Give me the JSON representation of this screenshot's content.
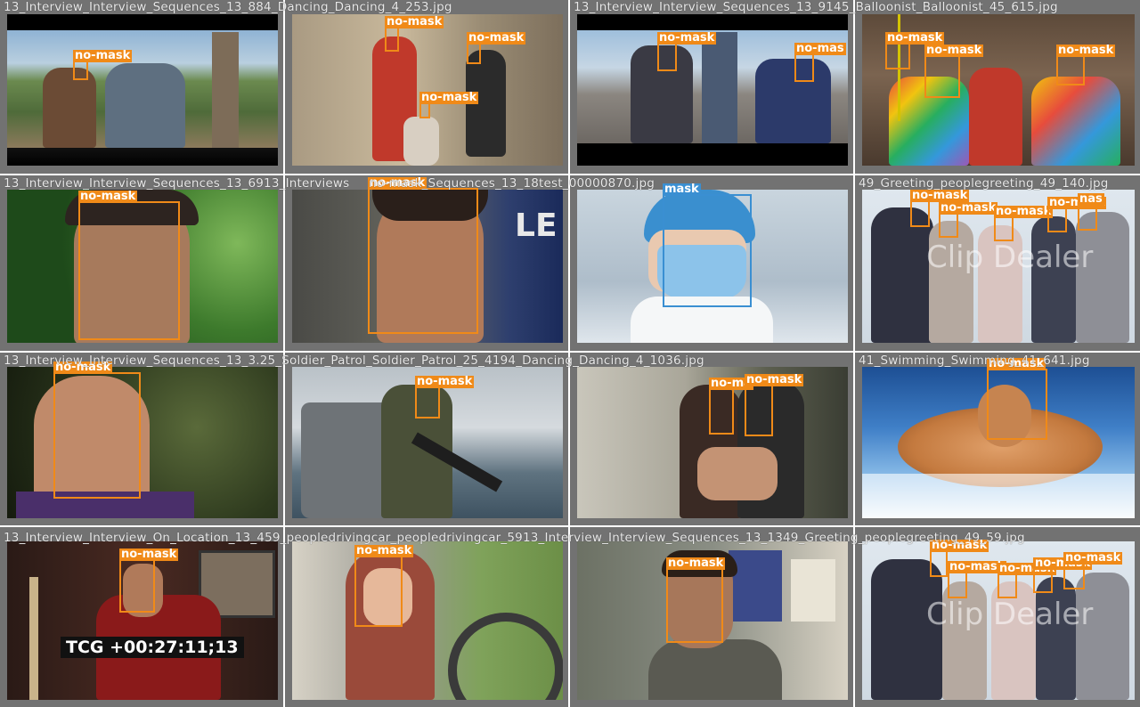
{
  "tiles": [
    {
      "filename": "13_Interview_Interview_Sequences_13_884_Dancing_Dancing_4_253.jpg",
      "labels": [
        "no-mask"
      ]
    },
    {
      "filename": "",
      "labels": [
        "no-mask",
        "no-mask",
        "no-mask"
      ]
    },
    {
      "filename": "13_Interview_Interview_Sequences_13_9145_Balloonist_Balloonist_45_615.jpg",
      "labels": [
        "no-mask",
        "no-mas"
      ]
    },
    {
      "filename": "",
      "labels": [
        "no-mask",
        "no-mask",
        "no-mask"
      ]
    },
    {
      "filename": "13_Interview_Interview_Sequences_13_6913_Interviews",
      "labels": [
        "no-mask"
      ]
    },
    {
      "filename": "no-mask_Sequences_13_18test_00000870.jpg",
      "labels": [
        "no-mask"
      ]
    },
    {
      "filename": "",
      "labels": [
        "mask"
      ]
    },
    {
      "filename": "49_Greeting_peoplegreeting_49_140.jpg",
      "labels": [
        "no-mask",
        "no-mask",
        "no-mask",
        "no-mask",
        "nas"
      ]
    },
    {
      "filename": "13_Interview_Interview_Sequences_13_3.25_Soldier_Patrol_Soldier_Patrol_25_4194_Dancing_Dancing_4_1036.jpg",
      "labels": [
        "no-mask"
      ]
    },
    {
      "filename": "",
      "labels": [
        "no-mask"
      ]
    },
    {
      "filename": "",
      "labels": [
        "no-ma",
        "no-mask"
      ]
    },
    {
      "filename": "41_Swimming_Swimming_41_641.jpg",
      "labels": [
        "no-mask"
      ]
    },
    {
      "filename": "13_Interview_Interview_On_Location_13_459_peopledrivingcar_peopledrivingcar_5913_Interview_Interview_Sequences_13_1349_Greeting_peoplegreeting_49_59.jpg",
      "labels": [
        "no-mask"
      ]
    },
    {
      "filename": "",
      "labels": [
        "no-mask"
      ]
    },
    {
      "filename": "",
      "labels": [
        "no-mask"
      ]
    },
    {
      "filename": "",
      "labels": [
        "no-mask",
        "no-mask",
        "no-mask",
        "no-mask",
        "no-mask"
      ]
    }
  ],
  "overlays": {
    "timecode": "TCG +00:27:11;13",
    "watermark": "Clip Dealer",
    "watermark2": "Clip Dealer"
  },
  "colors": {
    "no_mask_box": "#f08a18",
    "mask_box": "#3a8fd2",
    "tile_border": "#727272"
  }
}
